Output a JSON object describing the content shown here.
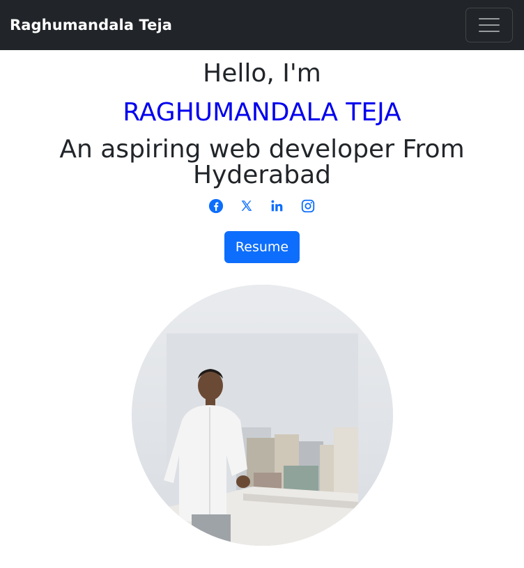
{
  "navbar": {
    "brand": "Raghumandala Teja",
    "toggler_icon": "hamburger-menu-icon"
  },
  "hero": {
    "greeting": "Hello, I'm",
    "name": "RAGHUMANDALA TEJA",
    "tagline": "An aspiring web developer From Hyderabad"
  },
  "socials": [
    {
      "icon": "facebook-icon"
    },
    {
      "icon": "x-icon"
    },
    {
      "icon": "linkedin-icon"
    },
    {
      "icon": "instagram-icon"
    }
  ],
  "resume_button": {
    "label": "Resume"
  },
  "photo": {
    "icon": "profile-photo"
  },
  "colors": {
    "navbar_bg": "#212529",
    "accent": "#0d6efd",
    "name_color": "#0000ee"
  }
}
